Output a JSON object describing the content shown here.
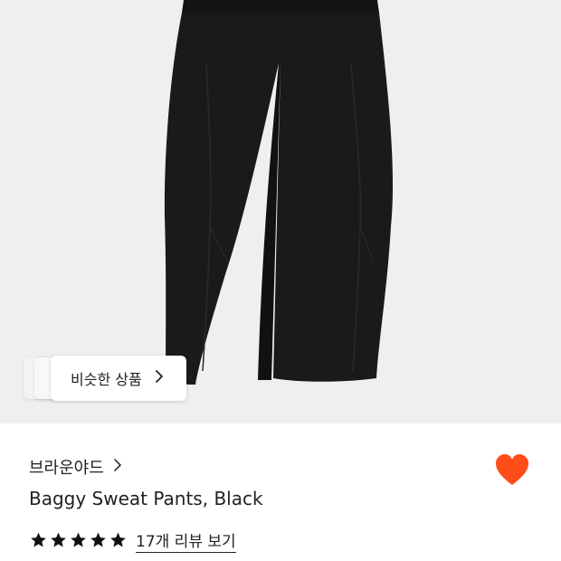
{
  "similar_button": {
    "label": "비슷한 상품"
  },
  "product": {
    "brand": "브라운야드",
    "title": "Baggy Sweat Pants, Black",
    "rating_stars": 5,
    "review_link": "17개 리뷰 보기",
    "favorite": true
  },
  "icons": {
    "chevron": "chevron-right-icon",
    "heart": "heart-icon",
    "star": "star-icon"
  },
  "colors": {
    "heart": "#ff4d1a",
    "image_bg": "#efefef",
    "text": "#222222"
  }
}
